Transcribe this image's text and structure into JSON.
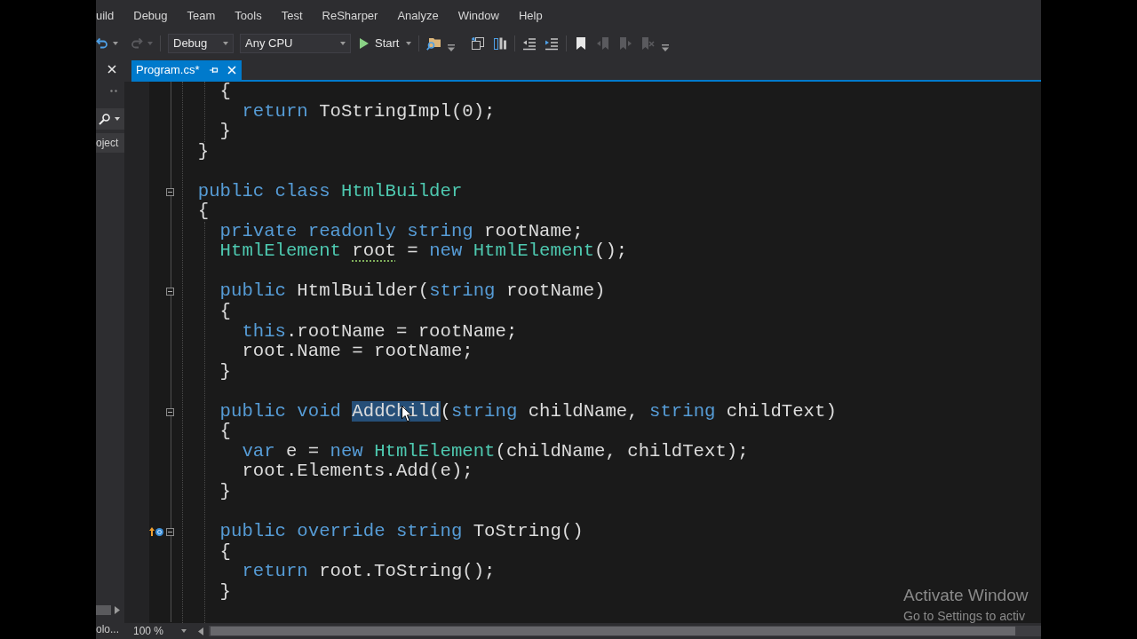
{
  "menu": {
    "items": [
      "uild",
      "Debug",
      "Team",
      "Tools",
      "Test",
      "ReSharper",
      "Analyze",
      "Window",
      "Help"
    ]
  },
  "toolbar": {
    "items": [
      {
        "kind": "undo",
        "disabled": false
      },
      {
        "kind": "redo",
        "disabled": true
      },
      {
        "kind": "separator"
      },
      {
        "kind": "combo",
        "value": "Debug"
      },
      {
        "kind": "combo",
        "value": "Any CPU"
      },
      {
        "kind": "start",
        "label": "Start"
      },
      {
        "kind": "separator"
      },
      {
        "kind": "find",
        "disabled": false
      },
      {
        "kind": "overflow"
      },
      {
        "kind": "windows",
        "disabled": false
      },
      {
        "kind": "columns",
        "disabled": false
      },
      {
        "kind": "separator"
      },
      {
        "kind": "outdent",
        "disabled": false
      },
      {
        "kind": "indent",
        "disabled": false
      },
      {
        "kind": "separator"
      },
      {
        "kind": "bookmark",
        "disabled": false
      },
      {
        "kind": "prevmark",
        "disabled": true
      },
      {
        "kind": "nextmark",
        "disabled": true
      },
      {
        "kind": "clearmark",
        "disabled": true
      },
      {
        "kind": "overflow"
      }
    ]
  },
  "side_panel": {
    "tree_item": "oject",
    "bottom_tab": "olo..."
  },
  "tabs": [
    {
      "label": "Program.cs*",
      "selected": true
    }
  ],
  "editor": {
    "lines": [
      {
        "kind": "code",
        "tokens": [
          {
            "text": "    {",
            "kind": "plain"
          }
        ]
      },
      {
        "kind": "code",
        "tokens": [
          {
            "text": "      return",
            "kind": "keyword"
          },
          {
            "text": " ToStringImpl(0);",
            "kind": "plain"
          }
        ]
      },
      {
        "kind": "code",
        "tokens": [
          {
            "text": "    }",
            "kind": "plain"
          }
        ]
      },
      {
        "kind": "code",
        "tokens": [
          {
            "text": "  }",
            "kind": "plain"
          }
        ]
      },
      {
        "kind": "blank"
      },
      {
        "kind": "code",
        "expanded": true,
        "tokens": [
          {
            "text": "  public class ",
            "kind": "keyword"
          },
          {
            "text": "HtmlBuilder",
            "kind": "type"
          }
        ]
      },
      {
        "kind": "code",
        "tokens": [
          {
            "text": "  {",
            "kind": "plain"
          }
        ]
      },
      {
        "kind": "code",
        "tokens": [
          {
            "text": "    private readonly string",
            "kind": "keyword"
          },
          {
            "text": " rootName;",
            "kind": "plain"
          }
        ]
      },
      {
        "kind": "code",
        "tokens": [
          {
            "text": "    HtmlElement ",
            "kind": "type"
          },
          {
            "text": "root",
            "kind": "hint"
          },
          {
            "text": " = ",
            "kind": "plain"
          },
          {
            "text": "new ",
            "kind": "keyword"
          },
          {
            "text": "HtmlElement",
            "kind": "type"
          },
          {
            "text": "();",
            "kind": "plain"
          }
        ]
      },
      {
        "kind": "blank"
      },
      {
        "kind": "code",
        "expanded": true,
        "tokens": [
          {
            "text": "    public",
            "kind": "keyword"
          },
          {
            "text": " HtmlBuilder(",
            "kind": "plain"
          },
          {
            "text": "string",
            "kind": "keyword"
          },
          {
            "text": " rootName)",
            "kind": "plain"
          }
        ]
      },
      {
        "kind": "code",
        "tokens": [
          {
            "text": "    {",
            "kind": "plain"
          }
        ]
      },
      {
        "kind": "code",
        "tokens": [
          {
            "text": "      this",
            "kind": "keyword"
          },
          {
            "text": ".rootName = rootName;",
            "kind": "plain"
          }
        ]
      },
      {
        "kind": "code",
        "tokens": [
          {
            "text": "      root.Name = rootName;",
            "kind": "plain"
          }
        ]
      },
      {
        "kind": "code",
        "tokens": [
          {
            "text": "    }",
            "kind": "plain"
          }
        ]
      },
      {
        "kind": "blank"
      },
      {
        "kind": "code",
        "expanded": true,
        "tokens": [
          {
            "text": "    public void ",
            "kind": "keyword"
          },
          {
            "text": "AddChild",
            "kind": "selected"
          },
          {
            "text": "(",
            "kind": "plain"
          },
          {
            "text": "string",
            "kind": "keyword"
          },
          {
            "text": " childName, ",
            "kind": "plain"
          },
          {
            "text": "string",
            "kind": "keyword"
          },
          {
            "text": " childText)",
            "kind": "plain"
          }
        ]
      },
      {
        "kind": "code",
        "tokens": [
          {
            "text": "    {",
            "kind": "plain"
          }
        ]
      },
      {
        "kind": "code",
        "tokens": [
          {
            "text": "      var",
            "kind": "keyword"
          },
          {
            "text": " e = ",
            "kind": "plain"
          },
          {
            "text": "new ",
            "kind": "keyword"
          },
          {
            "text": "HtmlElement",
            "kind": "type"
          },
          {
            "text": "(childName, childText);",
            "kind": "plain"
          }
        ]
      },
      {
        "kind": "code",
        "tokens": [
          {
            "text": "      root.Elements.Add(e);",
            "kind": "plain"
          }
        ]
      },
      {
        "kind": "code",
        "tokens": [
          {
            "text": "    }",
            "kind": "plain"
          }
        ]
      },
      {
        "kind": "blank"
      },
      {
        "kind": "code",
        "expanded": true,
        "gutter_icon": true,
        "tokens": [
          {
            "text": "    public override string",
            "kind": "keyword"
          },
          {
            "text": " ToString()",
            "kind": "plain"
          }
        ]
      },
      {
        "kind": "code",
        "tokens": [
          {
            "text": "    {",
            "kind": "plain"
          }
        ]
      },
      {
        "kind": "code",
        "tokens": [
          {
            "text": "      return",
            "kind": "keyword"
          },
          {
            "text": " root.ToString();",
            "kind": "plain"
          }
        ]
      },
      {
        "kind": "code",
        "tokens": [
          {
            "text": "    }",
            "kind": "plain"
          }
        ]
      },
      {
        "kind": "blank"
      }
    ],
    "zoom": "100 %"
  },
  "activation_notice": {
    "title": "Activate Window",
    "subtitle": "Go to Settings to activ"
  }
}
